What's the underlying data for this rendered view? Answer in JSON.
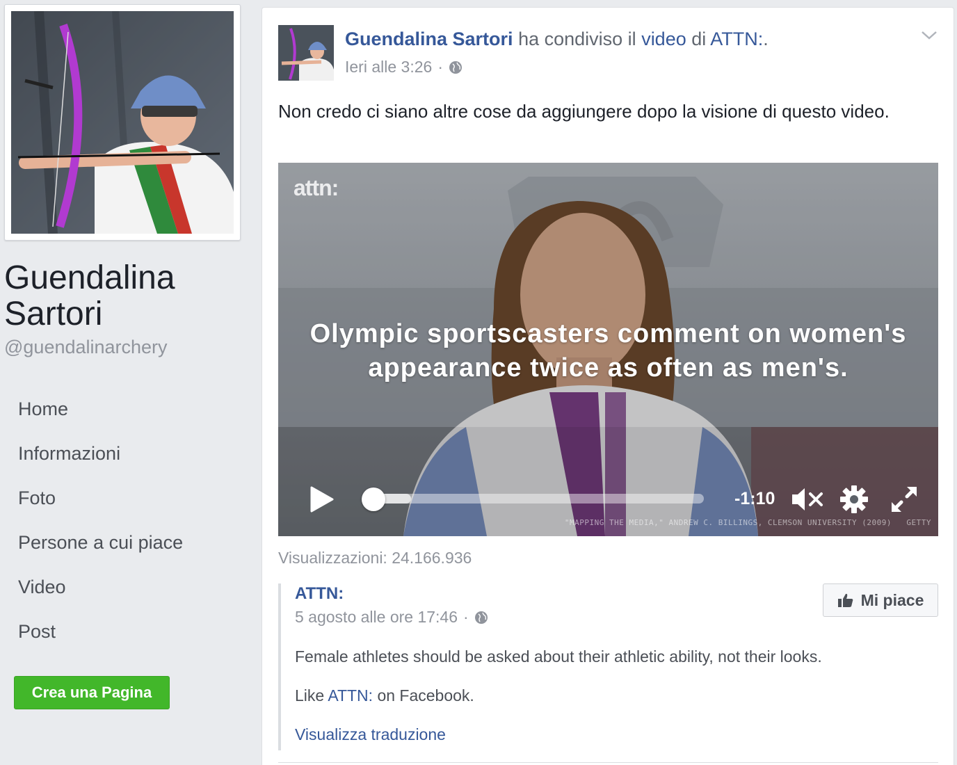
{
  "sidebar": {
    "name": "Guendalina Sartori",
    "handle": "@guendalinarchery",
    "nav": [
      {
        "label": "Home"
      },
      {
        "label": "Informazioni"
      },
      {
        "label": "Foto"
      },
      {
        "label": "Persone a cui piace"
      },
      {
        "label": "Video"
      },
      {
        "label": "Post"
      }
    ],
    "create_page_label": "Crea una Pagina"
  },
  "post": {
    "author": "Guendalina Sartori",
    "shared_text": "ha condiviso il",
    "video_link": "video",
    "of_text": "di",
    "source_link": "ATTN:",
    "period": ".",
    "timestamp": "Ieri alle 3:26",
    "dot": "·",
    "message": "Non credo ci siano altre cose da aggiungere dopo la visione di questo video.",
    "video": {
      "watermark": "attn:",
      "caption_line1": "Olympic sportscasters comment on women's",
      "caption_line2": "appearance twice as often as men's.",
      "time_remaining": "-1:10",
      "credits": "\"MAPPING THE MEDIA,\" ANDREW C. BILLINGS, CLEMSON UNIVERSITY (2009)",
      "credits_getty": "GETTY"
    },
    "views": "Visualizzazioni: 24.166.936",
    "shared": {
      "source": "ATTN:",
      "timestamp": "5 agosto alle ore 17:46",
      "dot": "·",
      "like_button": "Mi piace",
      "description": "Female athletes should be asked about their athletic ability, not their looks.",
      "like_prefix": "Like",
      "like_link": "ATTN:",
      "like_suffix": "on Facebook.",
      "translate": "Visualizza traduzione"
    }
  },
  "colors": {
    "link": "#365899",
    "green_button": "#42b72a",
    "meta_gray": "#90949c"
  }
}
